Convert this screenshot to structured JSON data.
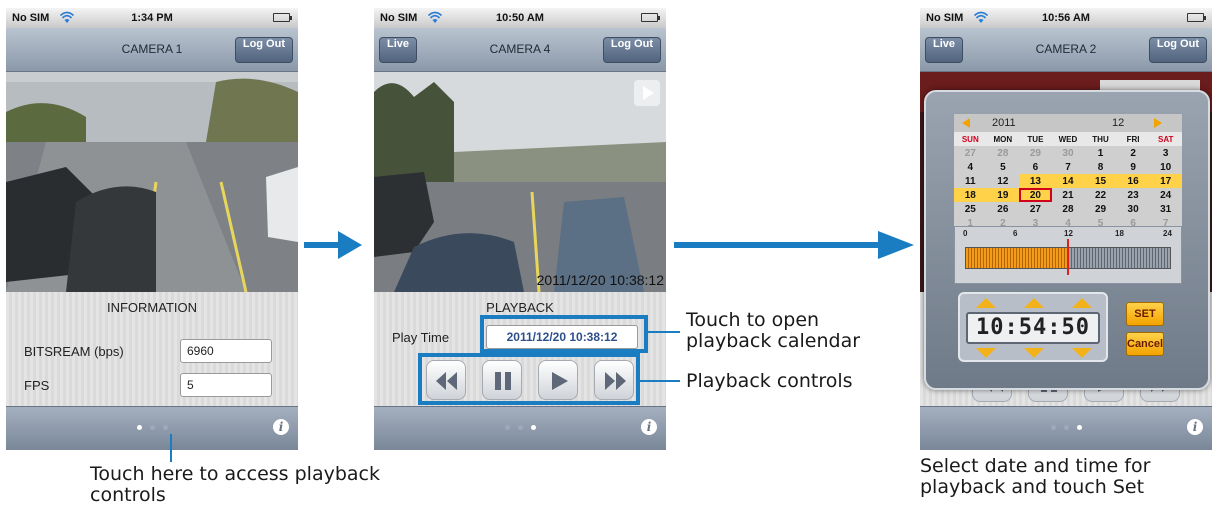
{
  "screens": [
    {
      "status": {
        "carrier": "No SIM",
        "time": "1:34 PM"
      },
      "nav": {
        "title": "CAMERA 1",
        "right_button": "Log Out"
      },
      "info_panel": {
        "title": "INFORMATION",
        "bitrate_label": "BITSREAM (bps)",
        "bitrate_value": "6960",
        "fps_label": "FPS",
        "fps_value": "5"
      },
      "page_dots": {
        "count": 3,
        "active": 1
      }
    },
    {
      "status": {
        "carrier": "No SIM",
        "time": "10:50 AM"
      },
      "nav": {
        "left_button": "Live",
        "title": "CAMERA 4",
        "right_button": "Log Out"
      },
      "video_timestamp": "2011/12/20 10:38:12",
      "playback_panel": {
        "title": "PLAYBACK",
        "play_time_label": "Play Time",
        "play_time_value": "2011/12/20 10:38:12"
      },
      "page_dots": {
        "count": 3,
        "active": 3
      }
    },
    {
      "status": {
        "carrier": "No SIM",
        "time": "10:56 AM"
      },
      "nav": {
        "left_button": "Live",
        "title": "CAMERA 2",
        "right_button": "Log Out"
      },
      "calendar": {
        "year": "2011",
        "month": "12",
        "weekdays": [
          "SUN",
          "MON",
          "TUE",
          "WED",
          "THU",
          "FRI",
          "SAT"
        ],
        "weeks": [
          [
            "27",
            "28",
            "29",
            "30",
            "1",
            "2",
            "3"
          ],
          [
            "4",
            "5",
            "6",
            "7",
            "8",
            "9",
            "10"
          ],
          [
            "11",
            "12",
            "13",
            "14",
            "15",
            "16",
            "17"
          ],
          [
            "18",
            "19",
            "20",
            "21",
            "22",
            "23",
            "24"
          ],
          [
            "25",
            "26",
            "27",
            "28",
            "29",
            "30",
            "31"
          ],
          [
            "1",
            "2",
            "3",
            "4",
            "5",
            "6",
            "7"
          ]
        ],
        "selected_day": "20"
      },
      "timeline": {
        "ticks": [
          "0",
          "6",
          "12",
          "18",
          "24"
        ],
        "recorded_fraction": 0.5,
        "position_fraction": 0.5
      },
      "time_picker": {
        "hour": "10",
        "minute": "54",
        "second": "50",
        "set_label": "SET",
        "cancel_label": "Cancel"
      },
      "page_dots": {
        "count": 3,
        "active": 3
      }
    }
  ],
  "callouts": {
    "access_playback": "Touch here to access playback controls",
    "open_calendar": "Touch to open playback calendar",
    "playback_controls": "Playback controls",
    "select_date": "Select date and time for playback and touch Set"
  },
  "colors": {
    "accent_blue": "#1a7dc1",
    "button_orange": "#f3a300"
  },
  "icons": [
    "wifi-icon",
    "battery-icon",
    "rewind-icon",
    "pause-icon",
    "play-icon",
    "fast-forward-icon",
    "info-icon",
    "arrow-right-icon"
  ]
}
